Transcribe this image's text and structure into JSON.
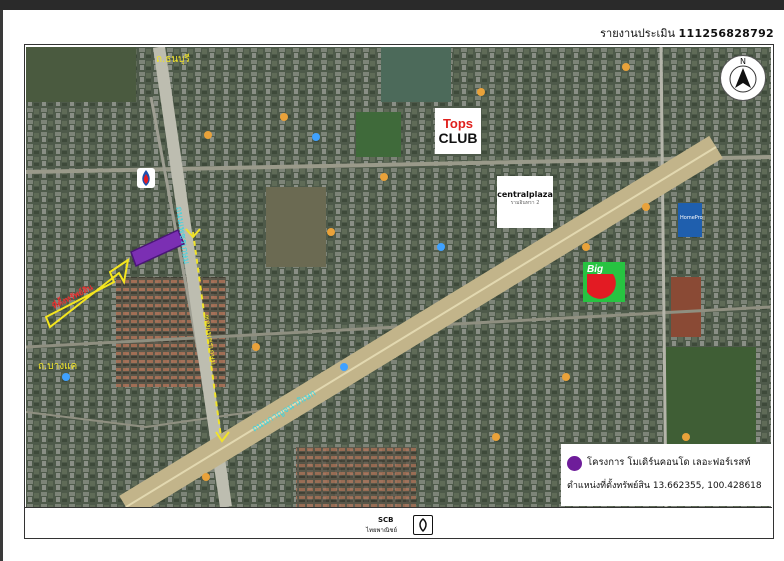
{
  "report": {
    "prefix": "รายงานประเมิน",
    "number": "111256828792"
  },
  "compass": {
    "label": "N"
  },
  "map_labels": {
    "road_top_left": "ถ.ธนบุรี",
    "road_left": "ถ.บางแค",
    "vertical_road": "ถนนเพชรเกษม",
    "dashed_route": "ซอยเพชรเกษม",
    "arrow_text": "ที่ตั้งทรัพย์สิน",
    "expressway": "ถนนกาญจนาภิเษก"
  },
  "places": {
    "tops_line1": "Tops",
    "tops_line2": "CLUB",
    "central_line1": "centralplaza",
    "central_line2": "รามอินทรา 2",
    "big_c": "Big",
    "homepro": "HomePro"
  },
  "legend": {
    "project": "โครงการ โมเดิร์นคอนโด เลอะฟอร์เรสท์",
    "coords": "ตำแหน่งที่ตั้งทรัพย์สิน  13.662355, 100.428618",
    "marker_color": "#6e1d9a"
  },
  "footer": {
    "brand": "SCB",
    "brand_sub": "ไทยพาณิชย์"
  }
}
